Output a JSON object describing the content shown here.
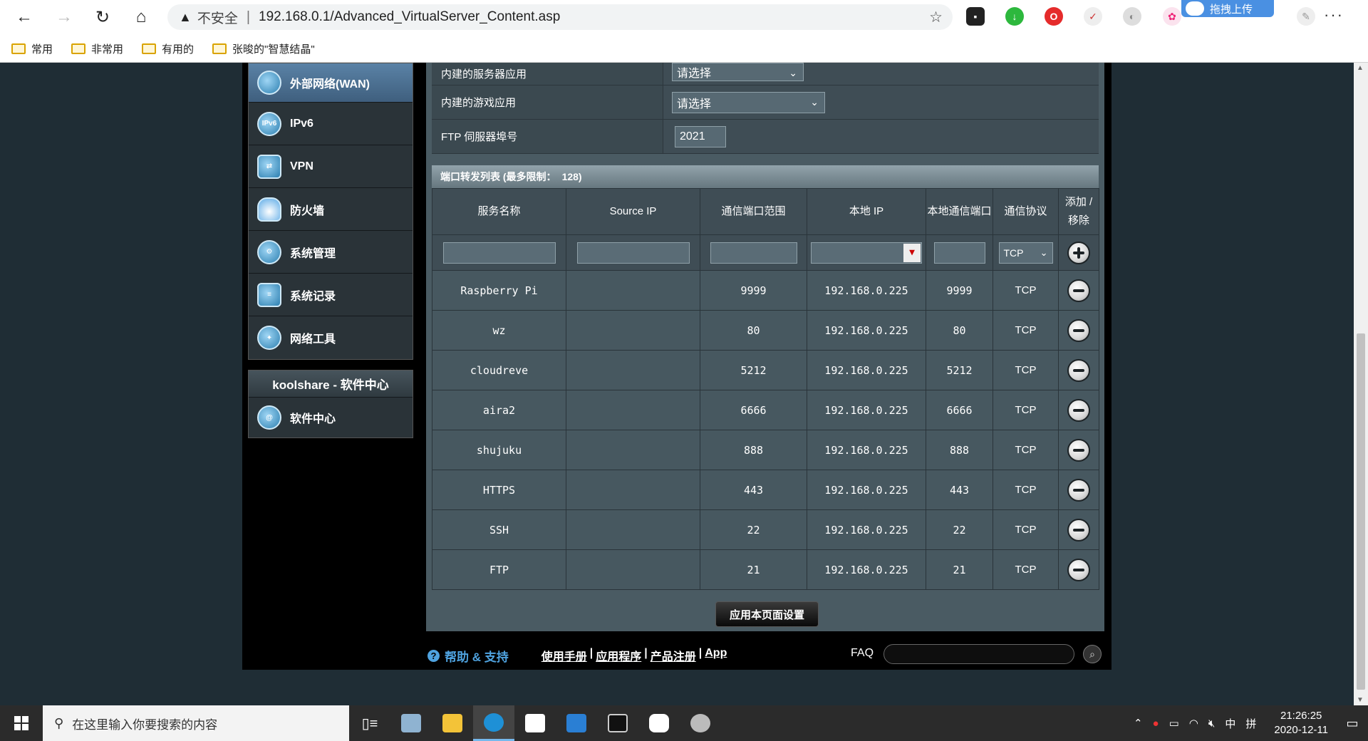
{
  "browser": {
    "insecure_label": "不安全",
    "url": "192.168.0.1/Advanced_VirtualServer_Content.asp",
    "upload_badge": "拖拽上传",
    "bookmarks": [
      "常用",
      "非常用",
      "有用的",
      "张晙的\"智慧结晶\""
    ]
  },
  "sidebar": {
    "items": [
      {
        "label": "外部网络(WAN)",
        "icon": "globe-icon",
        "active": true
      },
      {
        "label": "IPv6",
        "icon": "ipv6-icon"
      },
      {
        "label": "VPN",
        "icon": "vpn-icon"
      },
      {
        "label": "防火墙",
        "icon": "firewall-icon"
      },
      {
        "label": "系统管理",
        "icon": "admin-icon"
      },
      {
        "label": "系统记录",
        "icon": "log-icon"
      },
      {
        "label": "网络工具",
        "icon": "tools-icon"
      }
    ],
    "koolshare_title": "koolshare - 软件中心",
    "koolshare_item": "软件中心"
  },
  "form": {
    "builtin_server_label": "内建的服务器应用",
    "builtin_server_value": "请选择",
    "builtin_game_label": "内建的游戏应用",
    "builtin_game_value": "请选择",
    "ftp_port_label": "FTP 伺服器埠号",
    "ftp_port_value": "2021"
  },
  "list": {
    "title": "端口转发列表 (最多限制：",
    "limit": "128)",
    "headers": [
      "服务名称",
      "Source IP",
      "通信端口范围",
      "本地 IP",
      "本地通信端口",
      "通信协议",
      "添加 / 移除"
    ],
    "input_protocol": "TCP",
    "rows": [
      {
        "name": "Raspberry Pi",
        "source_ip": "",
        "port_range": "9999",
        "local_ip": "192.168.0.225",
        "local_port": "9999",
        "protocol": "TCP"
      },
      {
        "name": "wz",
        "source_ip": "",
        "port_range": "80",
        "local_ip": "192.168.0.225",
        "local_port": "80",
        "protocol": "TCP"
      },
      {
        "name": "cloudreve",
        "source_ip": "",
        "port_range": "5212",
        "local_ip": "192.168.0.225",
        "local_port": "5212",
        "protocol": "TCP"
      },
      {
        "name": "aira2",
        "source_ip": "",
        "port_range": "6666",
        "local_ip": "192.168.0.225",
        "local_port": "6666",
        "protocol": "TCP"
      },
      {
        "name": "shujuku",
        "source_ip": "",
        "port_range": "888",
        "local_ip": "192.168.0.225",
        "local_port": "888",
        "protocol": "TCP"
      },
      {
        "name": "HTTPS",
        "source_ip": "",
        "port_range": "443",
        "local_ip": "192.168.0.225",
        "local_port": "443",
        "protocol": "TCP"
      },
      {
        "name": "SSH",
        "source_ip": "",
        "port_range": "22",
        "local_ip": "192.168.0.225",
        "local_port": "22",
        "protocol": "TCP"
      },
      {
        "name": "FTP",
        "source_ip": "",
        "port_range": "21",
        "local_ip": "192.168.0.225",
        "local_port": "21",
        "protocol": "TCP"
      }
    ]
  },
  "apply_label": "应用本页面设置",
  "footer": {
    "help": "帮助 & 支持",
    "links": [
      "使用手册",
      "应用程序",
      "产品注册",
      "App"
    ],
    "faq": "FAQ"
  },
  "taskbar": {
    "search_placeholder": "在这里输入你要搜索的内容",
    "ime_lang": "中",
    "ime_mode": "拼",
    "time": "21:26:25",
    "date": "2020-12-11"
  },
  "colors": {
    "content_bg": "#4a5b63",
    "sidebar_active": "#4b6f8f",
    "help_link": "#4fa3e0"
  }
}
